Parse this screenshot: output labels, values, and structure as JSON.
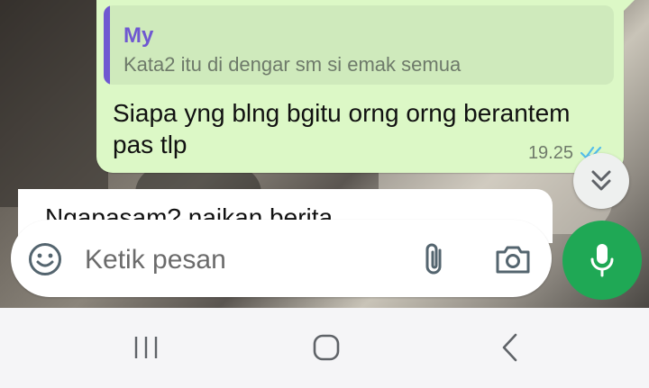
{
  "chat": {
    "outgoing": {
      "quoted_sender": "My",
      "quoted_text": "Kata2 itu di dengar sm si emak semua",
      "text": "Siapa yng blng bgitu orng orng berantem pas tlp",
      "time": "19.25",
      "status_icon": "double-check-icon",
      "status_color": "#53bdeb"
    },
    "incoming": {
      "text": "Ngapasam? naikan berita"
    },
    "scroll_down_icon": "double-chevron-down-icon"
  },
  "composer": {
    "placeholder": "Ketik pesan",
    "value": "",
    "emoji_icon": "emoji-icon",
    "attach_icon": "paperclip-icon",
    "camera_icon": "camera-icon",
    "mic_icon": "mic-icon",
    "mic_color": "#1fa855"
  },
  "colors": {
    "outgoing_bubble": "#dcf8c6",
    "quote_accent": "#6f58d1"
  },
  "system_nav": {
    "buttons": [
      "recents-icon",
      "home-icon",
      "back-icon"
    ]
  }
}
